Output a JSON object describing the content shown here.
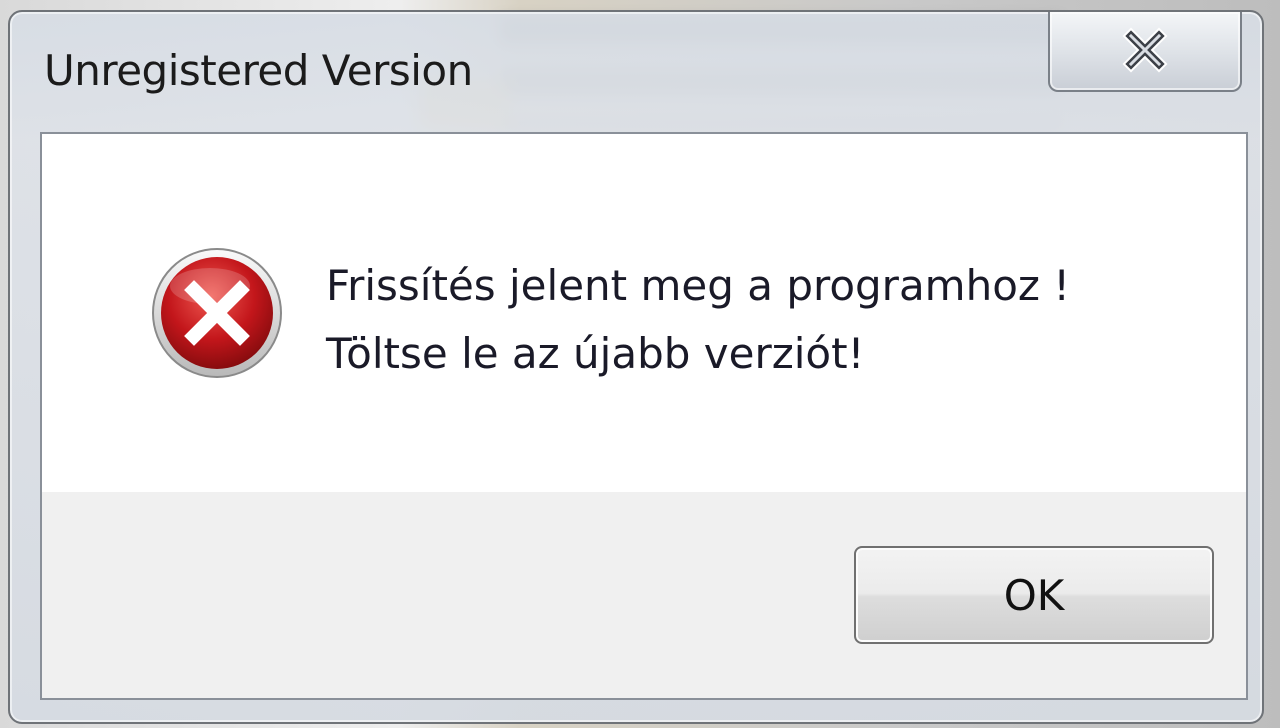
{
  "window": {
    "title": "Unregistered Version",
    "close_icon": "close-icon"
  },
  "dialog": {
    "icon": "error-icon",
    "message_lines": [
      "Frissítés jelent meg a programhoz !",
      "Töltse le az újabb verziót!"
    ],
    "ok_label": "OK"
  },
  "colors": {
    "error_red": "#c0161c",
    "error_ring": "#e8e8e8",
    "text": "#1a1a28"
  }
}
